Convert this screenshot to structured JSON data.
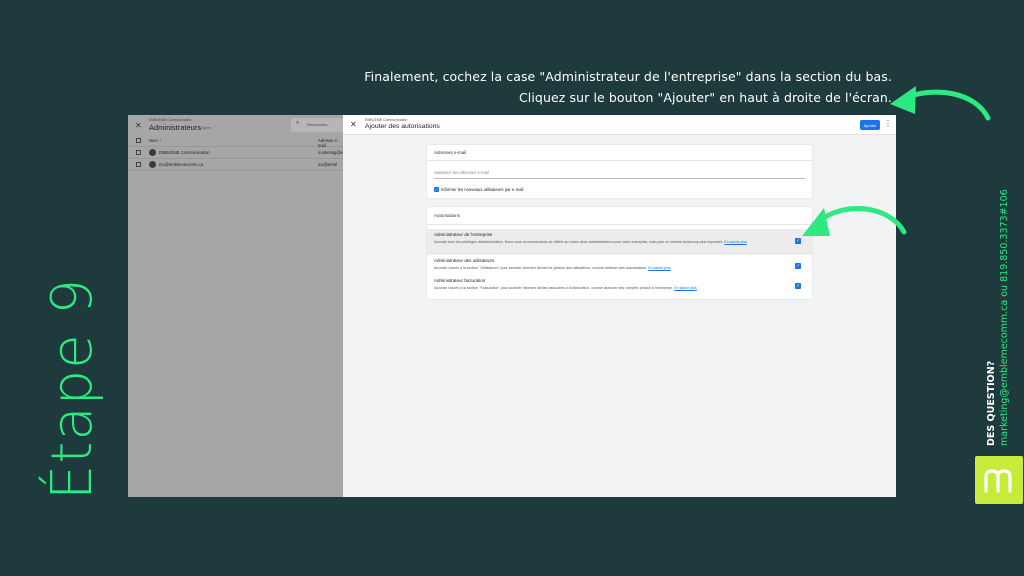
{
  "instruction": {
    "line1": "Finalement, cochez la case \"Administrateur de l'entreprise\" dans la section du bas.",
    "line2": "Cliquez sur le bouton \"Ajouter\" en haut à droite de l'écran."
  },
  "step_title": "Étape 9",
  "contact": {
    "title": "DES QUESTION?",
    "line": "marketing@emblemecomm.ca ou 819.850.3373#106"
  },
  "colors": {
    "accent": "#2ee882",
    "background": "#1e3a3c",
    "logo_bg": "#c5ec3b",
    "primary_button": "#1a73e8"
  },
  "left_pane": {
    "org": "EMBLÈME Communication",
    "title": "Administrateurs",
    "count": "2 lignes",
    "search_label": "Rechercher",
    "columns": [
      "Nom ↑",
      "Adresse e-mail"
    ],
    "rows": [
      {
        "name": "EMBLÈME Communication",
        "email": "marketing@e"
      },
      {
        "name": "mx@emblemecomm.ca",
        "email": "mx@embl"
      }
    ]
  },
  "dialog": {
    "org": "EMBLÈME Communication",
    "title": "Ajouter des autorisations",
    "add_button": "Ajouter",
    "email_section": {
      "title": "Adresses e-mail",
      "placeholder": "Saisissez les adresses e-mail",
      "notify_label": "Informer les nouveaux utilisateurs par e-mail"
    },
    "permissions_section": {
      "title": "Autorisations",
      "items": [
        {
          "title": "Administrateur de l'entreprise",
          "description": "Accorde tous les privilèges d'administration. Nous vous recommandons de définir au moins deux administrateurs pour votre entreprise, mais pas un nombre beaucoup plus important.",
          "link": "En savoir plus",
          "checked": true
        },
        {
          "title": "Administrateur des utilisateurs",
          "description": "Accorde l'accès à la section \"Utilisateurs\" pour accéder diverses tâches de gestion des utilisateurs, comme attribuer des autorisations.",
          "link": "En savoir plus",
          "checked": true
        },
        {
          "title": "Administrateur facturation",
          "description": "Accorde l'accès à la section \"Facturation\" pour accéder diverses tâches associées à la facturation, comme associer des comptes produit à l'entreprise.",
          "link": "En savoir plus",
          "checked": true
        }
      ]
    }
  }
}
